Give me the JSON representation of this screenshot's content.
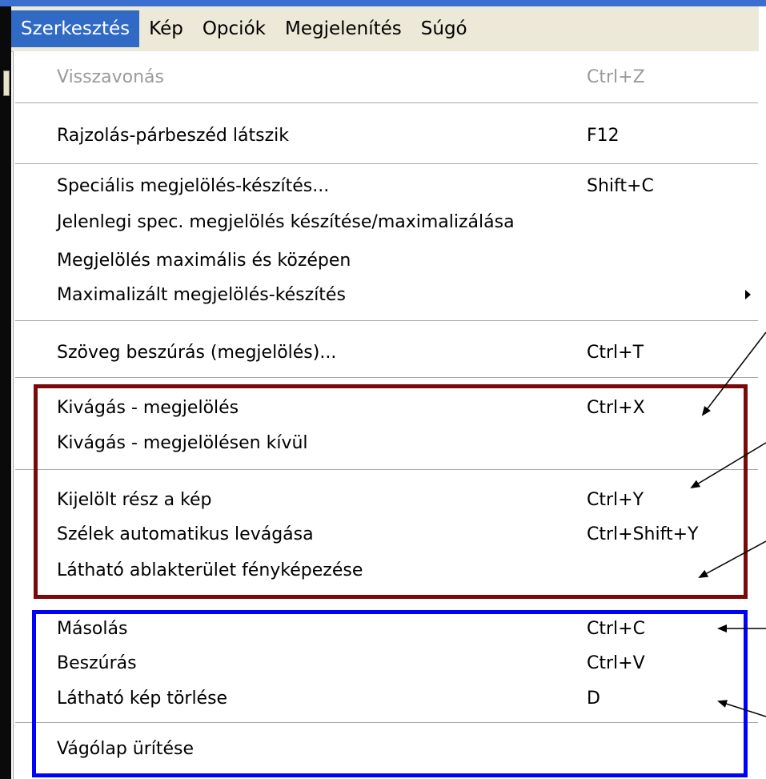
{
  "menubar": {
    "items": [
      {
        "label": "Szerkesztés",
        "active": true
      },
      {
        "label": "Kép"
      },
      {
        "label": "Opciók"
      },
      {
        "label": "Megjelenítés"
      },
      {
        "label": "Súgó"
      }
    ]
  },
  "menu": {
    "items": [
      {
        "label": "Visszavonás",
        "shortcut": "Ctrl+Z",
        "enabled": false
      },
      {
        "label": "Rajzolás-párbeszéd látszik",
        "shortcut": "F12"
      },
      {
        "label": "Speciális megjelölés-készítés...",
        "shortcut": "Shift+C"
      },
      {
        "label": "Jelenlegi spec. megjelölés készítése/maximalizálása",
        "shortcut": ""
      },
      {
        "label": "Megjelölés maximális és középen",
        "shortcut": ""
      },
      {
        "label": "Maximalizált megjelölés-készítés",
        "shortcut": "",
        "submenu": true
      },
      {
        "label": "Szöveg beszúrás (megjelölés)...",
        "shortcut": "Ctrl+T"
      },
      {
        "label": "Kivágás - megjelölés",
        "shortcut": "Ctrl+X"
      },
      {
        "label": "Kivágás - megjelölésen kívül",
        "shortcut": ""
      },
      {
        "label": "Kijelölt rész a kép",
        "shortcut": "Ctrl+Y"
      },
      {
        "label": "Szélek automatikus levágása",
        "shortcut": "Ctrl+Shift+Y"
      },
      {
        "label": "Látható ablakterület fényképezése",
        "shortcut": ""
      },
      {
        "label": "Másolás",
        "shortcut": "Ctrl+C"
      },
      {
        "label": "Beszúrás",
        "shortcut": "Ctrl+V"
      },
      {
        "label": "Látható kép törlése",
        "shortcut": "D"
      },
      {
        "label": "Vágólap ürítése",
        "shortcut": ""
      }
    ]
  },
  "colors": {
    "menubar_bg": "#ece9d8",
    "active_highlight": "#316ac5",
    "red_box": "#7a0a0a",
    "blue_box": "#0000ff",
    "disabled_text": "#9a9a9a"
  }
}
